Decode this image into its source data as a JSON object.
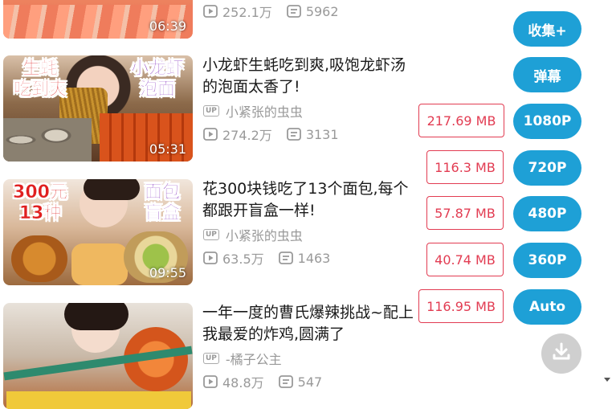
{
  "videos": [
    {
      "title": "",
      "duration": "06:39",
      "author": "",
      "views": "252.1万",
      "danmaku": "5962"
    },
    {
      "title": "小龙虾生蚝吃到爽,吸饱龙虾汤的泡面太香了!",
      "duration": "05:31",
      "author": "小紧张的虫虫",
      "views": "274.2万",
      "danmaku": "3131",
      "thumb_caption_left": "生蚝\n吃到爽",
      "thumb_caption_right": "小龙虾\n泡面"
    },
    {
      "title": "花300块钱吃了13个面包,每个都跟开盲盒一样!",
      "duration": "09:55",
      "author": "小紧张的虫虫",
      "views": "63.5万",
      "danmaku": "1463",
      "thumb_caption_left": "300元\n13种",
      "thumb_caption_right": "面包\n盲盒"
    },
    {
      "title": "一年一度的曹氏爆辣挑战~配上我最爱的炸鸡,圆满了",
      "duration": "",
      "author": "-橘子公主",
      "views": "48.8万",
      "danmaku": "547"
    }
  ],
  "badge_up": "UP",
  "sizes": [
    "217.69 MB",
    "116.3 MB",
    "57.87 MB",
    "40.74 MB",
    "116.95 MB"
  ],
  "buttons": {
    "favorite": "收集+",
    "danmaku": "弹幕",
    "q1080": "1080P",
    "q720": "720P",
    "q480": "480P",
    "q360": "360P",
    "auto": "Auto"
  },
  "colors": {
    "accent_blue": "#1ea0d6",
    "size_red": "#e23c52",
    "meta_gray": "#999999",
    "download_gray": "#cfcfcf"
  },
  "icons": {
    "views": "play-count-icon",
    "danmaku": "danmaku-count-icon",
    "download": "download-icon"
  }
}
